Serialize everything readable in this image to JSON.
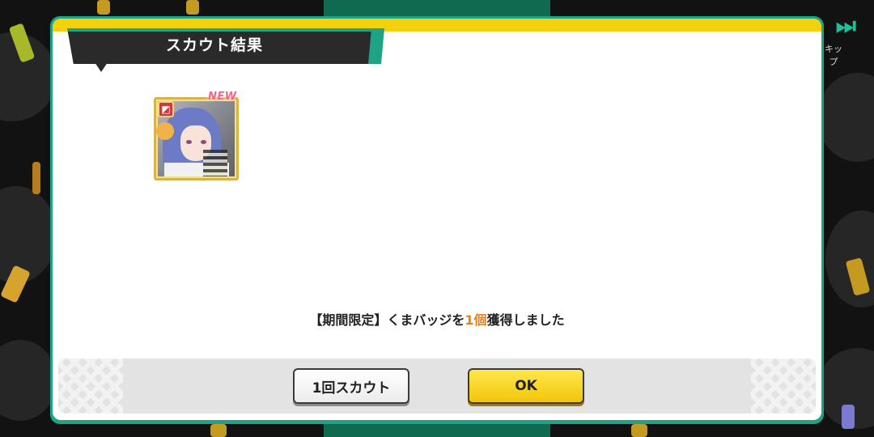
{
  "dialog": {
    "title": "スカウト結果",
    "message_prefix": "【期間限定】くまバッジを",
    "message_count": "1個",
    "message_suffix": "獲得しました"
  },
  "card": {
    "new_label": "NEW",
    "rarity_icon": "rarity-emblem-icon",
    "attribute_icon": "attribute-sun-icon"
  },
  "buttons": {
    "scout_again": "1回スカウト",
    "ok": "OK"
  },
  "skip": {
    "label": "キップ",
    "icon": "skip-icon"
  },
  "colors": {
    "accent_teal": "#1ea387",
    "accent_yellow": "#f3d10c",
    "highlight_orange": "#e8801f",
    "title_plate": "#2a2a2a"
  }
}
